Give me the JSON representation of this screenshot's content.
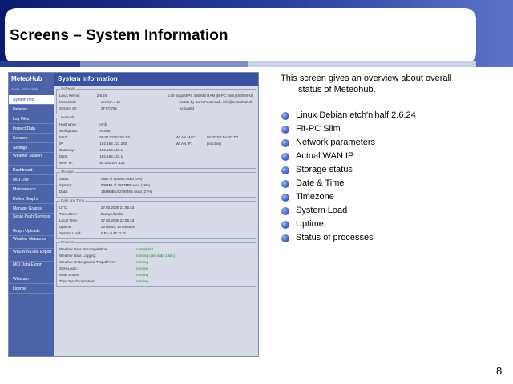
{
  "slide": {
    "title": "Screens – System Information",
    "page_number": "8",
    "description_line1": "This screen gives an overview about overall",
    "description_line2": "status of Meteohub.",
    "bullets": [
      "Linux Debian etch'n'half 2.6.24",
      "Fit-PC Slim",
      "Network parameters",
      "Actual WAN IP",
      "Storage status",
      "Date & Time",
      "Timezone",
      "System Load",
      "Uptime",
      "Status of processes"
    ]
  },
  "screenshot": {
    "logo": "MeteoHub",
    "date": "22:08 - 27.02.2009",
    "header_title": "System Information",
    "nav": [
      "System Info",
      "Network",
      "Log Files",
      "Inspect Data",
      "Sensors",
      "Settings",
      "Weather Station",
      "Dashboard",
      "MCI Live",
      "Maintenance",
      "Define Graphs",
      "Manage Graphs",
      "Setup Push Services",
      "Graph Uploads",
      "Weather Networks",
      "WIS/WIN Data Export",
      "MCI Data Export",
      "Webcam",
      "License"
    ],
    "software": {
      "legend": "Software",
      "rows": [
        [
          "Linux Kernel:",
          "2.6.24",
          "1.00 BogoMIPS 456 MB RAM (fit-PC Slim) (500 MHz)"
        ],
        [
          "Meteohub:",
          "Version 4.1e",
          "©2009 by Boris Pasternak, info@meteohub.de"
        ],
        [
          "System ID:",
          "3F77c78e",
          "activated"
        ]
      ]
    },
    "network": {
      "legend": "Network",
      "rows": [
        [
          "Hostname:",
          "mhfit",
          "",
          ""
        ],
        [
          "Workgroup:",
          "HOME",
          "",
          ""
        ],
        [
          "MAC:",
          "00:01:C0:04:9E:02",
          "WLAN MAC:",
          "00:0C:F6:5A:3C:D2"
        ],
        [
          "IP:",
          "192.168.123.220",
          "WLAN IP:",
          "(inactive)"
        ],
        [
          "Gateway:",
          "192.168.123.1",
          "",
          ""
        ],
        [
          "DNS:",
          "192.168.123.1",
          "",
          ""
        ],
        [
          "WAN IP:",
          "84.140.207.123",
          "",
          ""
        ]
      ]
    },
    "storage": {
      "legend": "Storage",
      "rows": [
        [
          "Swap:",
          "0MB of 109MB used (0%)"
        ],
        [
          "System:",
          "506MB of 2597MB used (18%)"
        ],
        [
          "Data:",
          "1849MB of 2756MB used (27%)"
        ]
      ]
    },
    "datetime": {
      "legend": "Date and Time",
      "rows": [
        [
          "UTC:",
          "27.02.2009 21:55:43"
        ],
        [
          "Time Zone:",
          "Europe/Berlin"
        ],
        [
          "Local Time:",
          "27.02.2009 22:55:43"
        ],
        [
          "Uptime:",
          "23 hours, 14 minutes"
        ],
        [
          "System Load:",
          "0.52, 0.47, 0.31"
        ]
      ]
    },
    "process": {
      "legend": "Process",
      "rows": [
        [
          "Weather Data Recomputation:",
          "completed"
        ],
        [
          "Weather Data Logging:",
          "running (last data 1 sec)"
        ],
        [
          "Weather Underground \"Rapid Fire\":",
          "running"
        ],
        [
          "SSH Login:",
          "running"
        ],
        [
          "SMB Shares:",
          "running"
        ],
        [
          "Time Synchronization:",
          "running"
        ]
      ]
    }
  }
}
